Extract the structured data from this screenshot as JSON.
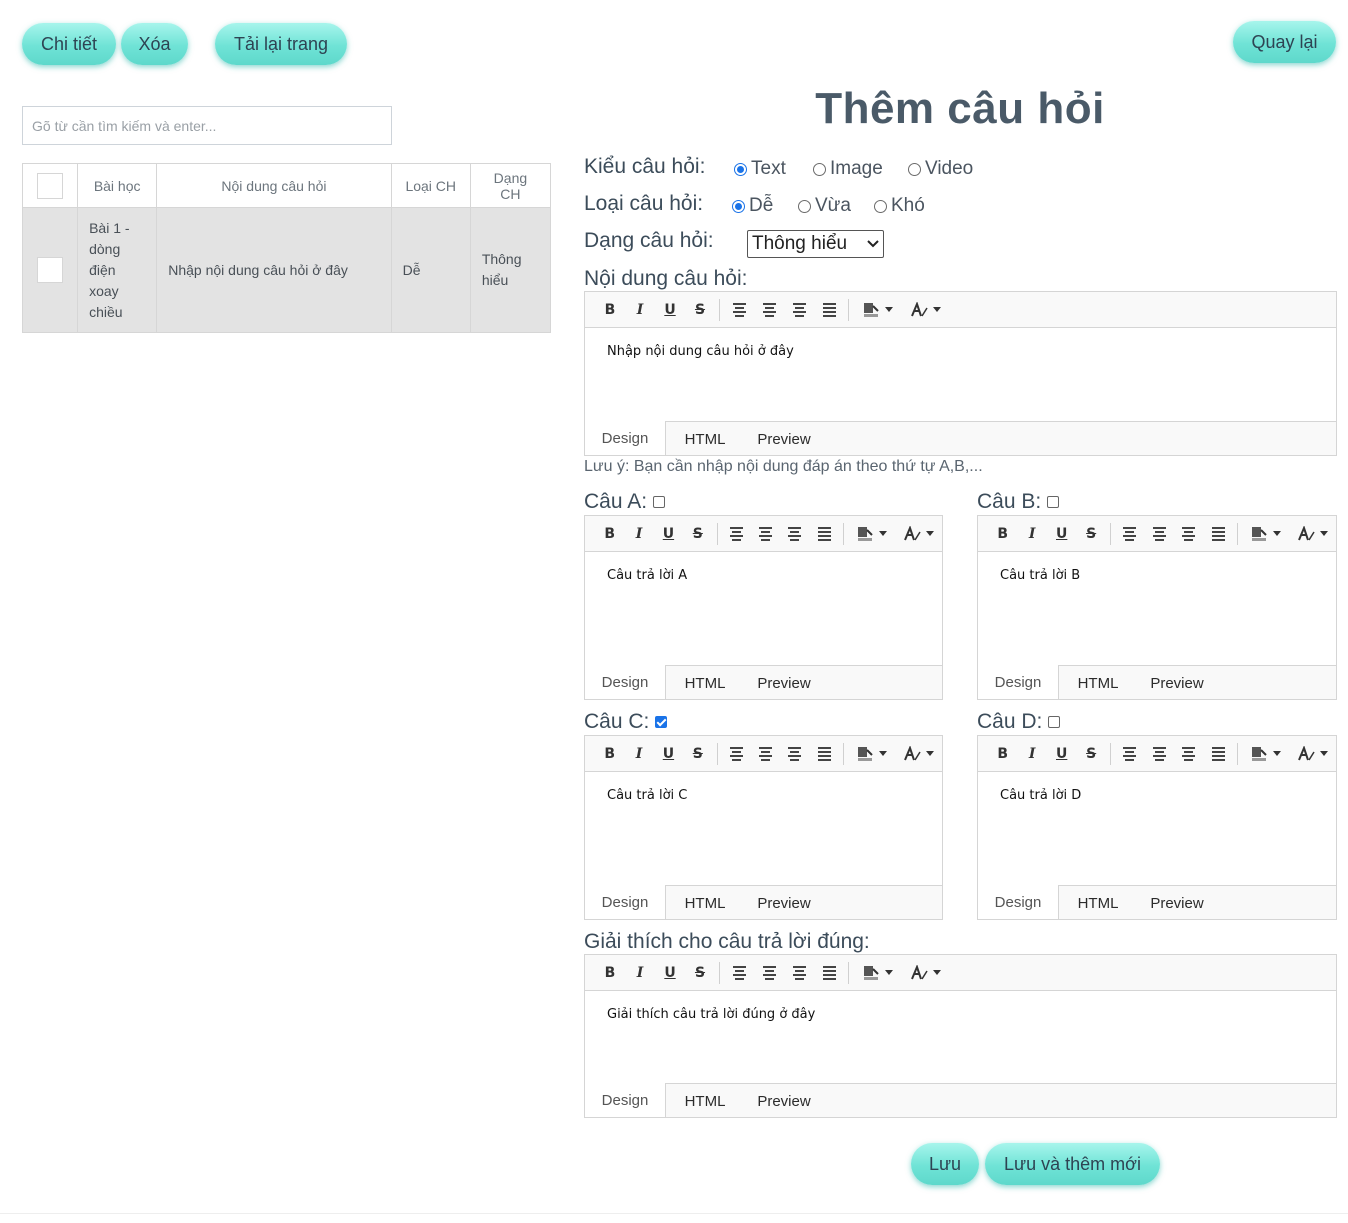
{
  "toolbar": {
    "detail_label": "Chi tiết",
    "delete_label": "Xóa",
    "reload_label": "Tải lại trang",
    "back_label": "Quay lại"
  },
  "search": {
    "placeholder": "Gõ từ cần tìm kiếm và enter..."
  },
  "table": {
    "headers": [
      "Bài học",
      "Nội dung câu hỏi",
      "Loại CH",
      "Dạng CH"
    ],
    "rows": [
      {
        "lesson": "Bài 1 - dòng điện xoay chiều",
        "content": "Nhập nội dung câu hỏi ở đây",
        "level": "Dễ",
        "form": "Thông hiểu"
      }
    ]
  },
  "form": {
    "title": "Thêm câu hỏi",
    "type_label": "Kiểu câu hỏi:",
    "type_options": [
      "Text",
      "Image",
      "Video"
    ],
    "type_selected": "Text",
    "level_label": "Loại câu hỏi:",
    "level_options": [
      "Dễ",
      "Vừa",
      "Khó"
    ],
    "level_selected": "Dễ",
    "form_label": "Dạng câu hỏi:",
    "form_selected": "Thông hiểu",
    "content_label": "Nội dung câu hỏi:",
    "content_value": "Nhập nội dung câu hỏi ở đây",
    "note": "Lưu ý: Bạn cần nhập nội dung đáp án theo thứ tự A,B,...",
    "answers": [
      {
        "label": "Câu A:",
        "value": "Câu trả lời A",
        "correct": false
      },
      {
        "label": "Câu B:",
        "value": "Câu trả lời B",
        "correct": false
      },
      {
        "label": "Câu C:",
        "value": "Câu trả lời C",
        "correct": true
      },
      {
        "label": "Câu D:",
        "value": "Câu trả lời D",
        "correct": false
      }
    ],
    "explanation_label": "Giải thích cho câu trả lời đúng:",
    "explanation_value": "Giải thích câu trả lời đúng ở đây",
    "save_label": "Lưu",
    "save_new_label": "Lưu và thêm mới"
  },
  "editor": {
    "tabs": [
      "Design",
      "HTML",
      "Preview"
    ],
    "toolbar_buttons": [
      "B",
      "I",
      "U",
      "S"
    ]
  },
  "colors": {
    "accent": "#6fe3d6",
    "radio": "#1a73e8",
    "title": "#4a5a68"
  }
}
